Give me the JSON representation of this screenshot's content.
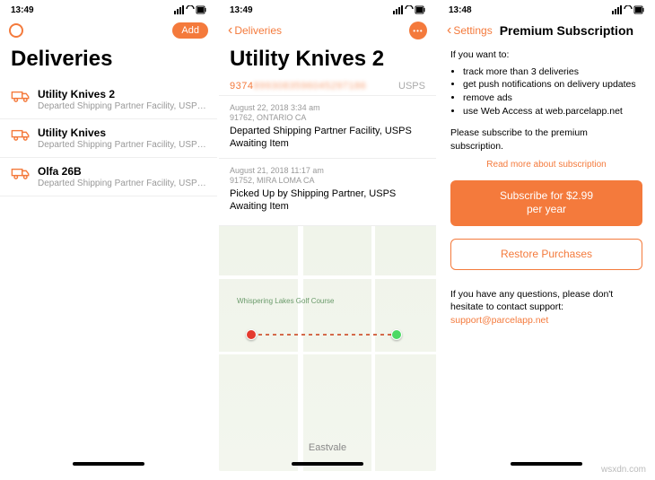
{
  "screen1": {
    "time": "13:49",
    "add_label": "Add",
    "title": "Deliveries",
    "items": [
      {
        "title": "Utility Knives 2",
        "sub": "Departed Shipping Partner Facility, USPS Aw..."
      },
      {
        "title": "Utility Knives",
        "sub": "Departed Shipping Partner Facility, USPS Aw..."
      },
      {
        "title": "Olfa 26B",
        "sub": "Departed Shipping Partner Facility, USPS Aw..."
      }
    ]
  },
  "screen2": {
    "time": "13:49",
    "back_label": "Deliveries",
    "title": "Utility Knives 2",
    "tracking_prefix": "9374",
    "tracking_rest": "8993083596045297186",
    "carrier": "USPS",
    "events": [
      {
        "ts": "August 22, 2018 3:34 am",
        "loc": "91762, ONTARIO CA",
        "desc": "Departed Shipping Partner Facility, USPS Awaiting Item"
      },
      {
        "ts": "August 21, 2018 11:17 am",
        "loc": "91752, MIRA LOMA CA",
        "desc": "Picked Up by Shipping Partner, USPS Awaiting Item"
      }
    ],
    "map": {
      "golf_label": "Whispering Lakes Golf Course",
      "city_label": "Eastvale"
    }
  },
  "screen3": {
    "time": "13:48",
    "back_label": "Settings",
    "title": "Premium Subscription",
    "intro": "If you want to:",
    "bullets": [
      "track more than 3 deliveries",
      "get push notifications on delivery updates",
      "remove ads",
      "use Web Access at web.parcelapp.net"
    ],
    "please": "Please subscribe to the premium subscription.",
    "readmore": "Read more about subscription",
    "subscribe_line1": "Subscribe for $2.99",
    "subscribe_line2": "per year",
    "restore": "Restore Purchases",
    "contact_text": "If you have any questions, please don't hesitate to contact support:",
    "contact_email": "support@parcelapp.net"
  },
  "watermark": "wsxdn.com"
}
